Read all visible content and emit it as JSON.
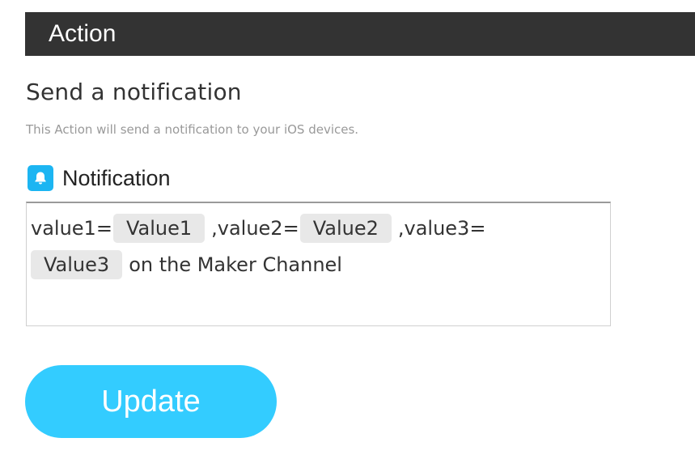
{
  "header": {
    "title": "Action"
  },
  "action": {
    "title": "Send a notification",
    "description": "This Action will send a notification to your iOS devices."
  },
  "field": {
    "label": "Notification",
    "icon": "bell-icon",
    "icon_color": "#1cb5f2",
    "content": {
      "seg1": "value1=",
      "chip1": "Value1",
      "seg2": ",value2=",
      "chip2": "Value2",
      "seg3": ",value3=",
      "chip3": "Value3",
      "seg4": "on the Maker Channel"
    }
  },
  "buttons": {
    "update_label": "Update",
    "update_color": "#33ccff"
  },
  "colors": {
    "header_bg": "#333333",
    "chip_bg": "#e8e8e8"
  }
}
